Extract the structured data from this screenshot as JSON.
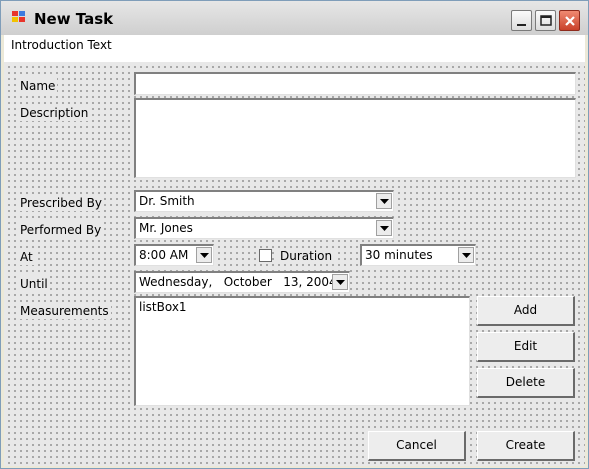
{
  "window": {
    "title": "New Task"
  },
  "intro": {
    "text": "Introduction Text"
  },
  "labels": {
    "name": "Name",
    "description": "Description",
    "prescribed_by": "Prescribed By",
    "performed_by": "Performed By",
    "at": "At",
    "until": "Until",
    "measurements": "Measurements",
    "duration": "Duration"
  },
  "fields": {
    "name_value": "",
    "description_value": "",
    "prescribed_by": "Dr. Smith",
    "performed_by": "Mr. Jones",
    "at_time": "8:00 AM",
    "duration": "30 minutes",
    "until_date": "Wednesday,   October   13, 2004",
    "list_text": "listBox1",
    "duration_checked": false
  },
  "buttons": {
    "add": "Add",
    "edit": "Edit",
    "delete": "Delete",
    "cancel": "Cancel",
    "create": "Create"
  },
  "icons": [
    "app-icon",
    "minimize-icon",
    "maximize-icon",
    "close-icon",
    "chevron-down-icon"
  ]
}
